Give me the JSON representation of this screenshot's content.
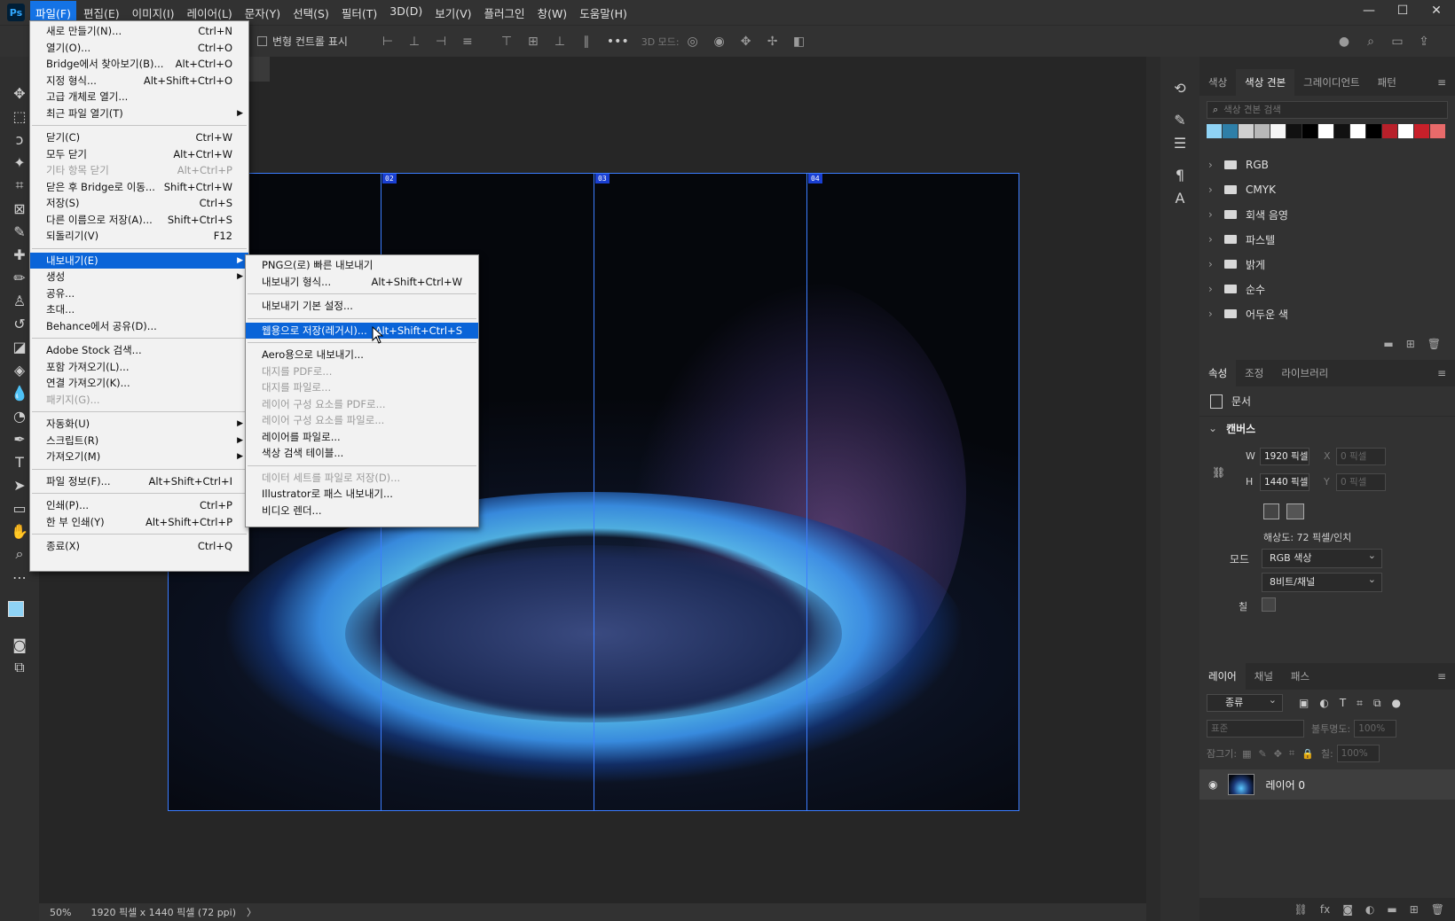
{
  "app": {
    "logo": "Ps"
  },
  "menubar": [
    "파일(F)",
    "편집(E)",
    "이미지(I)",
    "레이어(L)",
    "문자(Y)",
    "선택(S)",
    "필터(T)",
    "3D(D)",
    "보기(V)",
    "플러그인",
    "창(W)",
    "도움말(H)"
  ],
  "window_controls": {
    "minimize": "—",
    "maximize": "☐",
    "close": "✕"
  },
  "options_bar": {
    "transform_label": "변형 컨트롤 표시",
    "mode3d": "3D 모드:",
    "more": "•••"
  },
  "file_menu": [
    {
      "label": "새로 만들기(N)...",
      "shortcut": "Ctrl+N"
    },
    {
      "label": "열기(O)...",
      "shortcut": "Ctrl+O"
    },
    {
      "label": "Bridge에서 찾아보기(B)...",
      "shortcut": "Alt+Ctrl+O"
    },
    {
      "label": "지정 형식...",
      "shortcut": "Alt+Shift+Ctrl+O"
    },
    {
      "label": "고급 개체로 열기...",
      "shortcut": ""
    },
    {
      "label": "최근 파일 열기(T)",
      "shortcut": "",
      "submenu": true
    },
    {
      "sep": true
    },
    {
      "label": "닫기(C)",
      "shortcut": "Ctrl+W"
    },
    {
      "label": "모두 닫기",
      "shortcut": "Alt+Ctrl+W"
    },
    {
      "label": "기타 항목 닫기",
      "shortcut": "Alt+Ctrl+P",
      "disabled": true
    },
    {
      "label": "닫은 후 Bridge로 이동...",
      "shortcut": "Shift+Ctrl+W"
    },
    {
      "label": "저장(S)",
      "shortcut": "Ctrl+S"
    },
    {
      "label": "다른 이름으로 저장(A)...",
      "shortcut": "Shift+Ctrl+S"
    },
    {
      "label": "되돌리기(V)",
      "shortcut": "F12"
    },
    {
      "sep": true
    },
    {
      "label": "내보내기(E)",
      "shortcut": "",
      "submenu": true,
      "highlight": true
    },
    {
      "label": "생성",
      "shortcut": "",
      "submenu": true
    },
    {
      "label": "공유...",
      "shortcut": ""
    },
    {
      "label": "초대...",
      "shortcut": ""
    },
    {
      "label": "Behance에서 공유(D)...",
      "shortcut": ""
    },
    {
      "sep": true
    },
    {
      "label": "Adobe Stock 검색...",
      "shortcut": ""
    },
    {
      "label": "포함 가져오기(L)...",
      "shortcut": ""
    },
    {
      "label": "연결 가져오기(K)...",
      "shortcut": ""
    },
    {
      "label": "패키지(G)...",
      "shortcut": "",
      "disabled": true
    },
    {
      "sep": true
    },
    {
      "label": "자동화(U)",
      "shortcut": "",
      "submenu": true
    },
    {
      "label": "스크립트(R)",
      "shortcut": "",
      "submenu": true
    },
    {
      "label": "가져오기(M)",
      "shortcut": "",
      "submenu": true
    },
    {
      "sep": true
    },
    {
      "label": "파일 정보(F)...",
      "shortcut": "Alt+Shift+Ctrl+I"
    },
    {
      "sep": true
    },
    {
      "label": "인쇄(P)...",
      "shortcut": "Ctrl+P"
    },
    {
      "label": "한 부 인쇄(Y)",
      "shortcut": "Alt+Shift+Ctrl+P"
    },
    {
      "sep": true
    },
    {
      "label": "종료(X)",
      "shortcut": "Ctrl+Q"
    }
  ],
  "export_menu": [
    {
      "label": "PNG으(로) 빠른 내보내기",
      "shortcut": ""
    },
    {
      "label": "내보내기 형식...",
      "shortcut": "Alt+Shift+Ctrl+W"
    },
    {
      "sep": true
    },
    {
      "label": "내보내기 기본 설정...",
      "shortcut": ""
    },
    {
      "sep": true
    },
    {
      "label": "웹용으로 저장(레거시)...",
      "shortcut": "Alt+Shift+Ctrl+S",
      "highlight": true
    },
    {
      "sep": true
    },
    {
      "label": "Aero용으로 내보내기...",
      "shortcut": ""
    },
    {
      "label": "대지를 PDF로...",
      "shortcut": "",
      "disabled": true
    },
    {
      "label": "대지를 파일로...",
      "shortcut": "",
      "disabled": true
    },
    {
      "label": "레이어 구성 요소를 PDF로...",
      "shortcut": "",
      "disabled": true
    },
    {
      "label": "레이어 구성 요소를 파일로...",
      "shortcut": "",
      "disabled": true
    },
    {
      "label": "레이어를 파일로...",
      "shortcut": ""
    },
    {
      "label": "색상 검색 테이블...",
      "shortcut": ""
    },
    {
      "sep": true
    },
    {
      "label": "데이터 세트를 파일로 저장(D)...",
      "shortcut": "",
      "disabled": true
    },
    {
      "label": "Illustrator로 패스 내보내기...",
      "shortcut": ""
    },
    {
      "label": "비디오 렌더...",
      "shortcut": ""
    }
  ],
  "slices": [
    "02",
    "03",
    "04"
  ],
  "status": {
    "zoom": "50%",
    "doc_info": "1920 픽셀 x 1440 픽셀 (72 ppi)",
    "arrow": "〉"
  },
  "swatches_panel": {
    "tabs": [
      "색상",
      "색상 견본",
      "그레이디언트",
      "패턴"
    ],
    "active_tab": 1,
    "search_placeholder": "색상 견본 검색",
    "colors": [
      "#8fd3f5",
      "#2e7fa8",
      "#d0d0d0",
      "#b8b8b8",
      "#f5f5f5",
      "#111111",
      "#000000",
      "#ffffff",
      "#111111",
      "#ffffff",
      "#000000",
      "#b8202a",
      "#ffffff",
      "#c8202a",
      "#e86a6a"
    ],
    "groups": [
      "RGB",
      "CMYK",
      "회색 음영",
      "파스텔",
      "밝게",
      "순수",
      "어두운 색"
    ]
  },
  "properties_panel": {
    "tabs": [
      "속성",
      "조정",
      "라이브러리"
    ],
    "active_tab": 0,
    "doc_label": "문서",
    "section": "캔버스",
    "w_label": "W",
    "w_value": "1920 픽셀",
    "h_label": "H",
    "h_value": "1440 픽셀",
    "x_label": "X",
    "x_value": "0 픽셀",
    "y_label": "Y",
    "y_value": "0 픽셀",
    "resolution": "해상도: 72 픽셀/인치",
    "mode_label": "모드",
    "mode_value": "RGB 색상",
    "depth_value": "8비트/채널",
    "fill_label": "칠"
  },
  "layers_panel": {
    "tabs": [
      "레이어",
      "채널",
      "패스"
    ],
    "active_tab": 0,
    "filter_label": "종류",
    "blend_mode": "표준",
    "opacity_label": "불투명도:",
    "opacity_value": "100%",
    "lock_label": "잠그기:",
    "fill_label": "칠:",
    "fill_value": "100%",
    "layer_name": "레이어 0"
  }
}
